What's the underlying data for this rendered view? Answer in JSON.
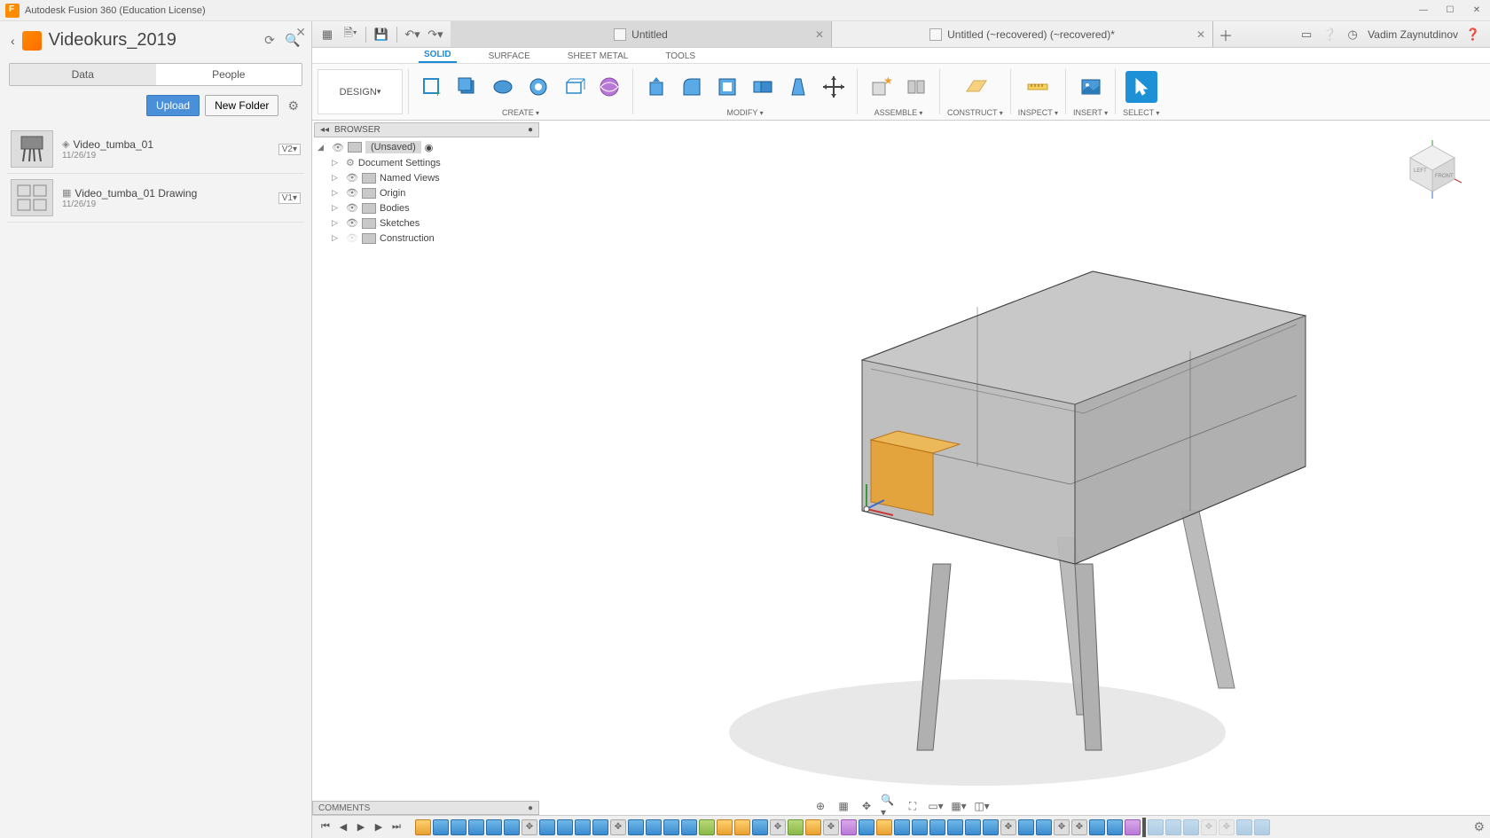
{
  "app": {
    "title": "Autodesk Fusion 360 (Education License)"
  },
  "datapanel": {
    "project": "Videokurs_2019",
    "tabs": {
      "data": "Data",
      "people": "People"
    },
    "actions": {
      "upload": "Upload",
      "newfolder": "New Folder"
    },
    "items": [
      {
        "name": "Video_tumba_01",
        "date": "11/26/19",
        "version": "V2▾",
        "kind": "model"
      },
      {
        "name": "Video_tumba_01 Drawing",
        "date": "11/26/19",
        "version": "V1▾",
        "kind": "drawing"
      }
    ]
  },
  "doctabs": [
    {
      "label": "Untitled",
      "active": false
    },
    {
      "label": "Untitled (~recovered) (~recovered)*",
      "active": true
    }
  ],
  "user": "Vadim Zaynutdinov",
  "workspace": {
    "design_label": "DESIGN",
    "tabs": [
      "SOLID",
      "SURFACE",
      "SHEET METAL",
      "TOOLS"
    ],
    "active_tab": "SOLID",
    "groups": [
      "CREATE",
      "MODIFY",
      "ASSEMBLE",
      "CONSTRUCT",
      "INSPECT",
      "INSERT",
      "SELECT"
    ]
  },
  "browser": {
    "title": "BROWSER",
    "root": "(Unsaved)",
    "nodes": [
      "Document Settings",
      "Named Views",
      "Origin",
      "Bodies",
      "Sketches",
      "Construction"
    ]
  },
  "comments": {
    "label": "COMMENTS"
  },
  "viewcube": {
    "left": "LEFT",
    "front": "FRONT"
  }
}
